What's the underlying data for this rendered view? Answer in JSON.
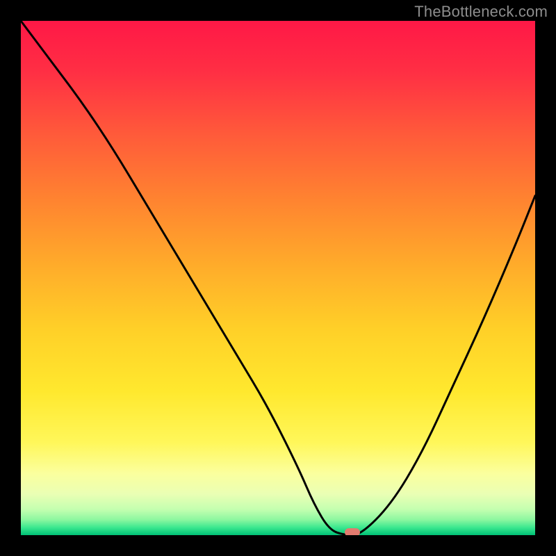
{
  "watermark": {
    "text": "TheBottleneck.com"
  },
  "chart_data": {
    "type": "line",
    "title": "",
    "xlabel": "",
    "ylabel": "",
    "xlim": [
      0,
      100
    ],
    "ylim": [
      0,
      100
    ],
    "grid": false,
    "series": [
      {
        "name": "bottleneck-curve",
        "x": [
          0,
          6,
          12,
          18,
          24,
          30,
          36,
          42,
          48,
          54,
          57,
          60,
          63,
          66,
          72,
          78,
          84,
          90,
          96,
          100
        ],
        "y": [
          100,
          92,
          84,
          75,
          65,
          55,
          45,
          35,
          25,
          13,
          6,
          1,
          0,
          0,
          6,
          16,
          29,
          42,
          56,
          66
        ]
      }
    ],
    "annotations": [
      {
        "name": "optimal-marker",
        "x": 64.5,
        "y": 0.6
      }
    ],
    "background_gradient": {
      "stops": [
        {
          "pct": 0,
          "color": "#ff1846"
        },
        {
          "pct": 10,
          "color": "#ff2f44"
        },
        {
          "pct": 22,
          "color": "#ff5a3a"
        },
        {
          "pct": 35,
          "color": "#ff8430"
        },
        {
          "pct": 48,
          "color": "#ffad2a"
        },
        {
          "pct": 60,
          "color": "#ffd028"
        },
        {
          "pct": 72,
          "color": "#ffe82e"
        },
        {
          "pct": 82,
          "color": "#fff75a"
        },
        {
          "pct": 88,
          "color": "#fbff9e"
        },
        {
          "pct": 92,
          "color": "#eaffb4"
        },
        {
          "pct": 95,
          "color": "#c4ffb0"
        },
        {
          "pct": 97,
          "color": "#8cf7a0"
        },
        {
          "pct": 98.5,
          "color": "#3be88f"
        },
        {
          "pct": 100,
          "color": "#00c176"
        }
      ]
    }
  }
}
